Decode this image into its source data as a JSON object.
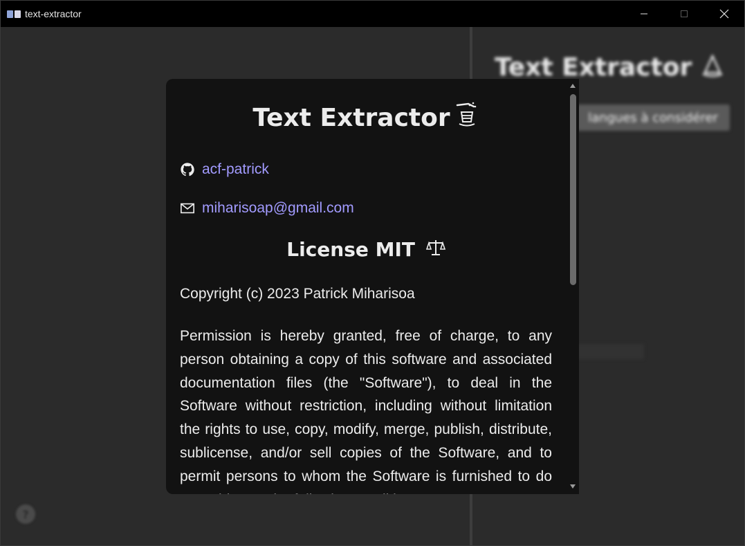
{
  "window": {
    "title": "text-extractor",
    "controls": [
      "minimize",
      "maximize",
      "close"
    ]
  },
  "background": {
    "app_title": "Text Extractor",
    "languages_button": "langues à considérer",
    "field_text": "…"
  },
  "modal": {
    "title": "Text Extractor",
    "github": {
      "icon": "github-icon",
      "label": "acf-patrick"
    },
    "email": {
      "icon": "envelope-icon",
      "label": "miharisoap@gmail.com"
    },
    "license_title": "License MIT",
    "license_icon": "scales-icon",
    "copyright": "Copyright (c) 2023 Patrick Miharisoa",
    "permission": "Permission is hereby granted, free of charge, to any person obtaining a copy of this software and associated documentation files (the \"Software\"), to deal in the Software without restriction, including without limitation the rights to use, copy, modify, merge, publish, distribute, sublicense, and/or sell copies of the Software, and to permit persons to whom the Software is furnished to do so, subject to the following conditions:"
  },
  "colors": {
    "titlebar": "#000000",
    "background": "#2b2b2b",
    "modal": "#121212",
    "link": "#a29bff",
    "text": "#ececec"
  }
}
